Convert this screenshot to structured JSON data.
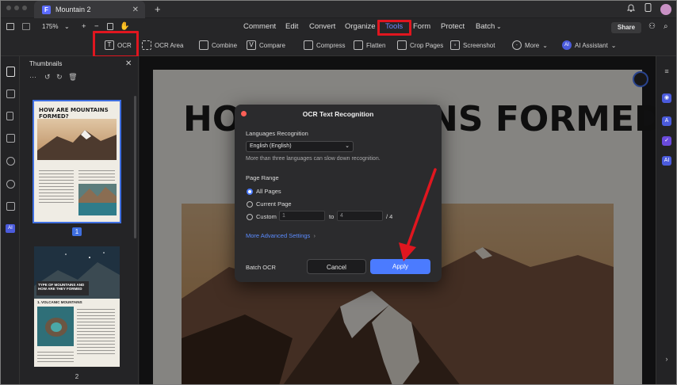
{
  "window": {
    "tab_title": "Mountain 2"
  },
  "menu": {
    "items": [
      "Comment",
      "Edit",
      "Convert",
      "Organize",
      "Tools",
      "Form",
      "Protect",
      "Batch"
    ],
    "active": "Tools",
    "share_label": "Share"
  },
  "zoom": "175%",
  "toolbar": {
    "ocr": "OCR",
    "ocr_area": "OCR Area",
    "combine": "Combine",
    "compare": "Compare",
    "compress": "Compress",
    "flatten": "Flatten",
    "crop_pages": "Crop Pages",
    "screenshot": "Screenshot",
    "more": "More",
    "ai_assistant": "AI Assistant",
    "ai_badge": "AI"
  },
  "thumbnails": {
    "title": "Thumbnails",
    "pages": [
      {
        "number": "1",
        "heading": "HOW ARE MOUNTAINS FORMED?"
      },
      {
        "number": "2",
        "heading": "TYPE OF MOUNTAINS AND HOW ARE THEY FORMED",
        "subheading": "1. VOLCANIC MOUNTAINS"
      }
    ]
  },
  "document": {
    "title": "HOW ARE MOUNTAINS FORMED?",
    "title_left": "HOW",
    "title_right": "NS FORMED?"
  },
  "dialog": {
    "title": "OCR Text Recognition",
    "languages_label": "Languages Recognition",
    "language_value": "English (English)",
    "language_hint": "More than three languages can slow down recognition.",
    "page_range_label": "Page Range",
    "options": [
      "All Pages",
      "Current Page",
      "Custom"
    ],
    "selected_option": "All Pages",
    "custom_from": "1",
    "to_label": "to",
    "custom_to": "4",
    "total_pages": "/ 4",
    "advanced_link": "More Advanced Settings",
    "batch_ocr": "Batch OCR",
    "cancel": "Cancel",
    "apply": "Apply"
  },
  "colors": {
    "accent": "#4b7bff",
    "highlight_red": "#e0161f",
    "dialog_bg": "#2b2b2d"
  }
}
